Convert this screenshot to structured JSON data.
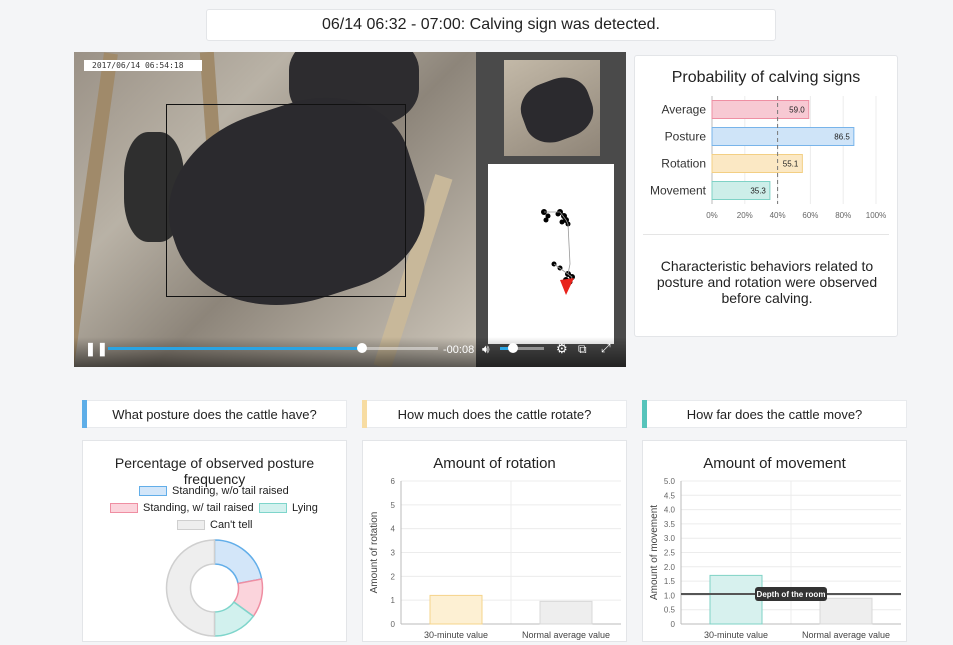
{
  "banner": {
    "text": "06/14 06:32 - 07:00: Calving sign was detected."
  },
  "video": {
    "timestamp": "2017/06/14  06:54:18",
    "time_remaining": "-00:08",
    "progress": 0.77,
    "volume": 0.3
  },
  "probability": {
    "title": "Probability of calving signs",
    "description": "Characteristic behaviors related to posture and rotation were observed before calving.",
    "chart_data": {
      "type": "bar",
      "orientation": "horizontal",
      "categories": [
        "Average",
        "Posture",
        "Rotation",
        "Movement"
      ],
      "values": [
        59.0,
        86.5,
        55.1,
        35.3
      ],
      "value_labels": [
        "59.0",
        "86.5",
        "55.1",
        "35.3"
      ],
      "colors": [
        "#f7c9d3",
        "#cfe4f8",
        "#fbe8c4",
        "#cdeee9"
      ],
      "border_colors": [
        "#ee8fa3",
        "#78b4ea",
        "#f3cf84",
        "#7fd2c6"
      ],
      "threshold": 40,
      "xlim": [
        0,
        100
      ],
      "xticks": [
        "0%",
        "20%",
        "40%",
        "60%",
        "80%",
        "100%"
      ]
    }
  },
  "questions": [
    {
      "label": "What posture does the cattle have?",
      "accent": "#5eaee8"
    },
    {
      "label": "How much does the cattle rotate?",
      "accent": "#f7dca2"
    },
    {
      "label": "How far does the cattle move?",
      "accent": "#56c4bb"
    }
  ],
  "posture": {
    "title": "Percentage of observed posture frequency",
    "legend": [
      "Standing, w/o tail raised",
      "Standing, w/ tail raised",
      "Lying",
      "Can't tell"
    ],
    "chart_data": {
      "type": "pie",
      "labels": [
        "Standing, w/o tail raised",
        "Standing, w/ tail raised",
        "Lying",
        "Can't tell"
      ],
      "values": [
        22,
        13,
        15,
        50
      ],
      "colors": [
        "#d3e6f9",
        "#fbd4dc",
        "#d2f1ee",
        "#eeeeee"
      ],
      "border_colors": [
        "#62aee9",
        "#ef8ea2",
        "#7ed5cb",
        "#cfcfcf"
      ]
    }
  },
  "rotation": {
    "title": "Amount of rotation",
    "chart_data": {
      "type": "bar",
      "categories": [
        "30-minute value",
        "Normal average value"
      ],
      "values": [
        1.2,
        0.95
      ],
      "ylabel": "Amount of rotation",
      "ylim": [
        0,
        6
      ],
      "yticks": [
        "0",
        "1",
        "2",
        "3",
        "4",
        "5",
        "6"
      ],
      "colors": [
        "#fdf0d3",
        "#eeeeee"
      ],
      "border_colors": [
        "#f5d48b",
        "#d8d8d8"
      ]
    }
  },
  "movement": {
    "title": "Amount of movement",
    "chart_data": {
      "type": "bar",
      "categories": [
        "30-minute value",
        "Normal average value"
      ],
      "values": [
        1.7,
        0.9
      ],
      "ylabel": "Amount of movement",
      "ylim": [
        0,
        5
      ],
      "yticks": [
        "0",
        "0.5",
        "1.0",
        "1.5",
        "2.0",
        "2.5",
        "3.0",
        "3.5",
        "4.0",
        "4.5",
        "5.0"
      ],
      "reference_line": {
        "value": 1.05,
        "label": "Depth of the room"
      },
      "colors": [
        "#d7f1ee",
        "#eeeeee"
      ],
      "border_colors": [
        "#7fd2c6",
        "#d8d8d8"
      ]
    }
  }
}
